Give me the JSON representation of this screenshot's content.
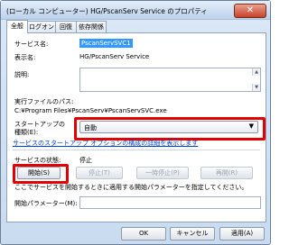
{
  "window": {
    "title": "(ローカル コンピューター) HG/PscanServ Service のプロパティ",
    "close_glyph": "✕"
  },
  "tabs": [
    {
      "label": "全般",
      "active": true
    },
    {
      "label": "ログオン",
      "active": false
    },
    {
      "label": "回復",
      "active": false
    },
    {
      "label": "依存関係",
      "active": false
    }
  ],
  "general": {
    "service_name_label": "サービス名:",
    "service_name_value": "PscanServSVC1",
    "display_name_label": "表示名:",
    "display_name_value": "HG/PscanServ Service",
    "description_label": "説明:",
    "exe_path_label": "実行ファイルのパス:",
    "exe_path_value": "C:¥Program Files¥PscanServ¥PscanServSVC.exe",
    "startup_type_label_line1": "スタートアップの",
    "startup_type_label_line2": "種類(E):",
    "startup_type_value": "自動",
    "startup_help_link": "サービスのスタートアップ オプションの構成の詳細を表示します",
    "status_label": "サービスの状態:",
    "status_value": "停止",
    "buttons": {
      "start": "開始(S)",
      "stop": "停止(T)",
      "pause": "一時停止(P)",
      "resume": "再開(R)"
    },
    "start_params_hint": "ここでサービスを開始するときに適用する開始パラメーターを指定してください。",
    "start_params_label": "開始パラメーター(M):",
    "start_params_value": ""
  },
  "footer": {
    "ok": "OK",
    "cancel": "キャンセル",
    "apply": "適用(A)"
  },
  "colors": {
    "highlight_box": "#e30000",
    "selection": "#3399ff",
    "link": "#0044cc"
  }
}
